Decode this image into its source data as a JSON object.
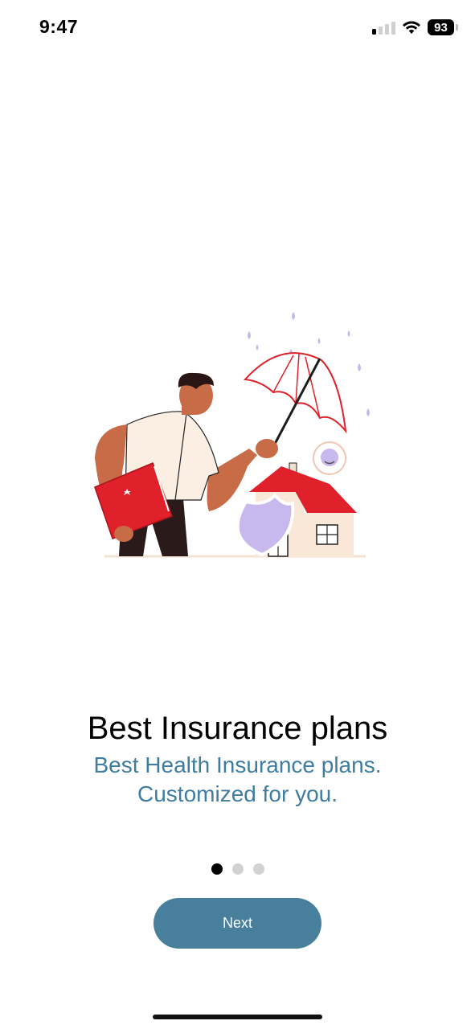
{
  "status_bar": {
    "time": "9:47",
    "battery_level": "93",
    "signal_bars_on": 1,
    "icons": [
      "signal-icon",
      "wifi-icon",
      "battery-icon"
    ]
  },
  "onboarding": {
    "title": "Best Insurance plans",
    "subtitle_line1": "Best Health Insurance plans.",
    "subtitle_line2": "Customized for you.",
    "page_count": 3,
    "current_page": 1
  },
  "actions": {
    "next_label": "Next"
  },
  "colors": {
    "accent": "#477f9c",
    "subtitle": "#3f7da0",
    "illustration_red": "#e0202a",
    "illustration_lilac": "#c9b8ee"
  }
}
